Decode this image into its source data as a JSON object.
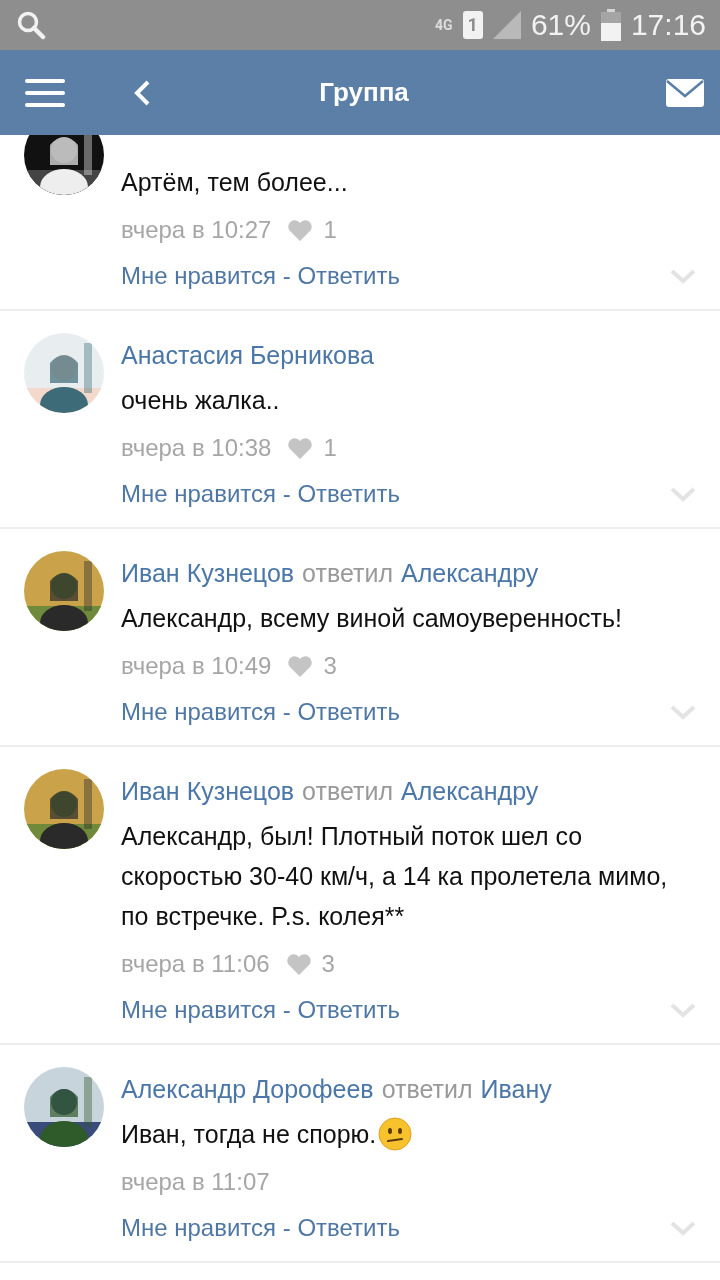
{
  "status_bar": {
    "network": "4G",
    "sim": "1",
    "battery": "61%",
    "time": "17:16"
  },
  "app_bar": {
    "title": "Группа"
  },
  "comments": [
    {
      "text": "Артём, тем более...",
      "time": "вчера в 10:27",
      "likes": "1",
      "actions": "Мне нравится - Ответить"
    },
    {
      "author": "Анастасия Берникова",
      "text": "очень жалка..",
      "time": "вчера в 10:38",
      "likes": "1",
      "actions": "Мне нравится - Ответить"
    },
    {
      "author": "Иван Кузнецов",
      "verb": "ответил",
      "recipient": "Александру",
      "text": "Александр, всему виной самоуверенность!",
      "time": "вчера в 10:49",
      "likes": "3",
      "actions": "Мне нравится - Ответить"
    },
    {
      "author": "Иван Кузнецов",
      "verb": "ответил",
      "recipient": "Александру",
      "text": "Александр, был! Плотный поток шел со скоростью 30-40 км/ч, а 14 ка пролетела мимо, по встречке. P.s. колея**",
      "time": "вчера в 11:06",
      "likes": "3",
      "actions": "Мне нравится - Ответить"
    },
    {
      "author": "Александр Дорофеев",
      "verb": "ответил",
      "recipient": "Ивану",
      "text": "Иван, тогда не спорю.",
      "trailing_icon": {
        "kind": "confused"
      },
      "time": "вчера в 11:07",
      "actions": "Мне нравится - Ответить"
    }
  ]
}
